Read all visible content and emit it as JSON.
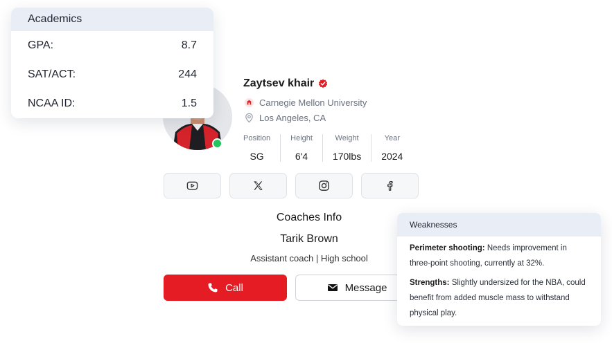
{
  "academics": {
    "title": "Academics",
    "rows": [
      {
        "label": "GPA:",
        "value": "8.7"
      },
      {
        "label": "SAT/ACT:",
        "value": "244"
      },
      {
        "label": "NCAA ID:",
        "value": "1.5"
      }
    ]
  },
  "profile": {
    "name": "Zaytsev khair",
    "university": "Carnegie Mellon University",
    "location": "Los Angeles, CA",
    "online": true,
    "stats": [
      {
        "label": "Position",
        "value": "SG"
      },
      {
        "label": "Height",
        "value": "6'4"
      },
      {
        "label": "Weight",
        "value": "170lbs"
      },
      {
        "label": "Year",
        "value": "2024"
      }
    ]
  },
  "socials": [
    {
      "icon": "youtube-icon"
    },
    {
      "icon": "x-icon"
    },
    {
      "icon": "instagram-icon"
    },
    {
      "icon": "facebook-icon"
    }
  ],
  "coach": {
    "section_title": "Coaches Info",
    "name": "Tarik Brown",
    "role": "Assistant coach | High school",
    "call_label": "Call",
    "message_label": "Message"
  },
  "weaknesses": {
    "title": "Weaknesses",
    "items": [
      {
        "heading": "Perimeter shooting:",
        "text": " Needs improvement in three-point shooting, currently at 32%."
      },
      {
        "heading": "Strengths:",
        "text": " Slightly undersized for the NBA, could benefit from added muscle mass to withstand physical play."
      }
    ]
  },
  "colors": {
    "accent_red": "#e51c23",
    "online_green": "#22c55e",
    "header_bg": "#e9eef6"
  }
}
